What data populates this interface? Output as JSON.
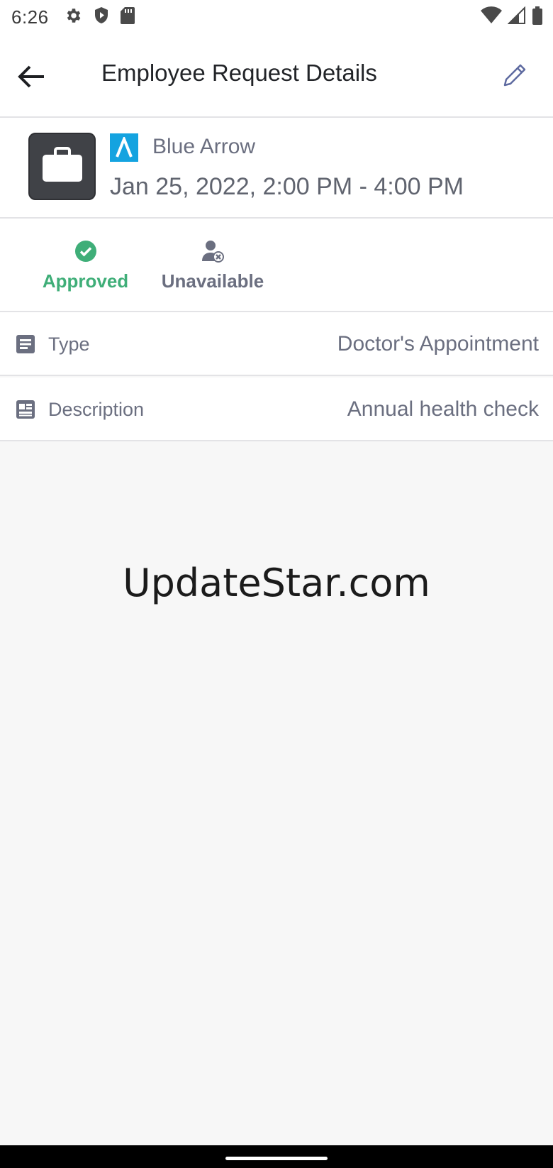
{
  "status_bar": {
    "time": "6:26",
    "left_icons": [
      "gear-icon",
      "shield-play-icon",
      "sd-card-icon"
    ],
    "right_icons": [
      "wifi-icon",
      "cell-signal-icon",
      "battery-icon"
    ]
  },
  "app_bar": {
    "title": "Employee Request Details",
    "back_icon": "arrow-back-icon",
    "edit_icon": "pencil-icon"
  },
  "request": {
    "category_icon": "briefcase-icon",
    "company_name": "Blue Arrow",
    "datetime": "Jan 25, 2022, 2:00 PM - 4:00 PM",
    "logo_color": "#14a3e0"
  },
  "statuses": [
    {
      "label": "Approved",
      "icon": "check-circle-icon",
      "color": "#3fae78"
    },
    {
      "label": "Unavailable",
      "icon": "person-x-icon",
      "color": "#6b6f80"
    }
  ],
  "details": {
    "type": {
      "label": "Type",
      "value": "Doctor's Appointment",
      "icon": "document-icon"
    },
    "description": {
      "label": "Description",
      "value": "Annual health check",
      "icon": "article-icon"
    }
  },
  "watermark": "UpdateStar.com"
}
